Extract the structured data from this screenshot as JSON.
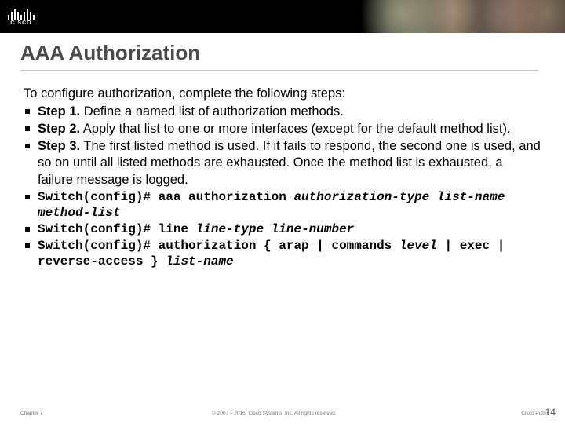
{
  "logo": {
    "text": "CISCO"
  },
  "title": "AAA Authorization",
  "intro": "To configure authorization, complete the following steps:",
  "steps": [
    {
      "label": "Step 1.",
      "text": " Define a named list of authorization methods."
    },
    {
      "label": "Step 2.",
      "text": " Apply that list to one or more interfaces (except for the default method list)."
    },
    {
      "label": "Step 3.",
      "text": " The first listed method is used. If it fails to respond, the second one is used, and so on until all listed methods are exhausted. Once the method list is exhausted, a failure message is logged."
    }
  ],
  "cmds": [
    {
      "prefix": "Switch(config)# aaa authorization ",
      "italic": "authorization-type list-name method-list"
    },
    {
      "prefix": "Switch(config)# line ",
      "italic": "line-type line-number"
    },
    {
      "prefix": "Switch(config)# authorization { arap | commands ",
      "italic": "level",
      "suffix": " | exec | reverse-access } ",
      "italic2": "list-name"
    }
  ],
  "footer": {
    "left": "Chapter 7",
    "center": "© 2007 – 2016, Cisco Systems, Inc. All rights reserved.",
    "right": "Cisco Public"
  },
  "page": "14"
}
